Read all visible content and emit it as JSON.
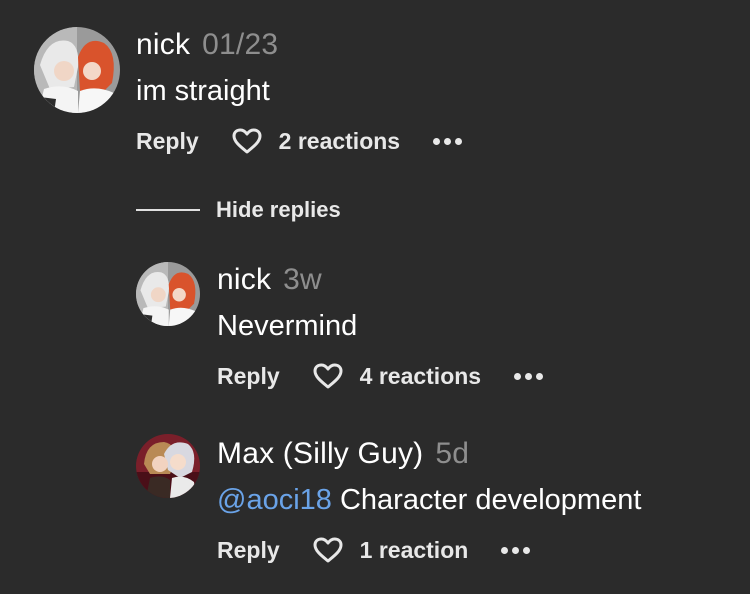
{
  "comments": [
    {
      "author": "nick",
      "time": "01/23",
      "text": "im straight",
      "actions": {
        "reply": "Reply",
        "reactions": "2 reactions"
      }
    }
  ],
  "thread": {
    "hide_replies": "Hide replies"
  },
  "replies": [
    {
      "author": "nick",
      "time": "3w",
      "text": "Nevermind",
      "actions": {
        "reply": "Reply",
        "reactions": "4 reactions"
      }
    },
    {
      "author": "Max (Silly Guy)",
      "time": "5d",
      "mention": "@aoci18",
      "text": " Character development",
      "actions": {
        "reply": "Reply",
        "reactions": "1 reaction"
      }
    }
  ],
  "icons": {
    "heart": "heart-outline-icon",
    "more": "more-horizontal-icon"
  },
  "colors": {
    "background": "#2b2b2b",
    "timestamp": "#8e8e8e",
    "mention": "#6aa3e8",
    "text": "#ffffff"
  }
}
